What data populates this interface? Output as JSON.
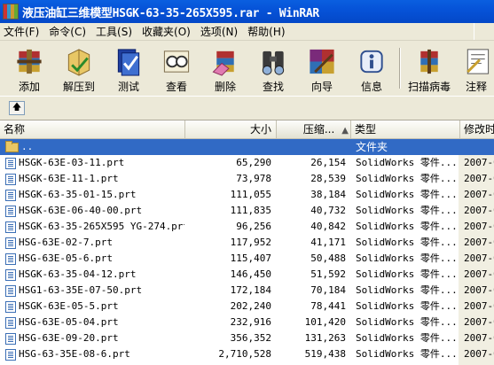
{
  "window": {
    "title": "液压油缸三维模型HSGK-63-35-265X595.rar - WinRAR"
  },
  "menu": [
    "文件(F)",
    "命令(C)",
    "工具(S)",
    "收藏夹(O)",
    "选项(N)",
    "帮助(H)"
  ],
  "toolbar": [
    {
      "label": "添加",
      "icon": "add-archive-icon"
    },
    {
      "label": "解压到",
      "icon": "extract-to-icon"
    },
    {
      "label": "测试",
      "icon": "test-icon"
    },
    {
      "label": "查看",
      "icon": "view-icon"
    },
    {
      "label": "删除",
      "icon": "delete-icon"
    },
    {
      "label": "查找",
      "icon": "find-icon"
    },
    {
      "label": "向导",
      "icon": "wizard-icon"
    },
    {
      "label": "信息",
      "icon": "info-icon"
    },
    {
      "label": "扫描病毒",
      "icon": "scan-virus-icon"
    },
    {
      "label": "注释",
      "icon": "comment-icon"
    }
  ],
  "columns": {
    "name": "名称",
    "size": "大小",
    "packed": "压缩...",
    "type": "类型",
    "modified": "修改时"
  },
  "parent_row": {
    "name": "..",
    "type": "文件夹"
  },
  "files": [
    {
      "name": "HSGK-63E-03-11.prt",
      "size": "65,290",
      "packed": "26,154",
      "type": "SolidWorks 零件...",
      "date": "2007-0"
    },
    {
      "name": "HSGK-63E-11-1.prt",
      "size": "73,978",
      "packed": "28,539",
      "type": "SolidWorks 零件...",
      "date": "2007-0"
    },
    {
      "name": "HSGK-63-35-01-15.prt",
      "size": "111,055",
      "packed": "38,184",
      "type": "SolidWorks 零件...",
      "date": "2007-0"
    },
    {
      "name": "HSGK-63E-06-40-00.prt",
      "size": "111,835",
      "packed": "40,732",
      "type": "SolidWorks 零件...",
      "date": "2007-0"
    },
    {
      "name": "HSGK-63-35-265X595 YG-274.prt",
      "size": "96,256",
      "packed": "40,842",
      "type": "SolidWorks 零件...",
      "date": "2007-0"
    },
    {
      "name": "HSG-63E-02-7.prt",
      "size": "117,952",
      "packed": "41,171",
      "type": "SolidWorks 零件...",
      "date": "2007-0"
    },
    {
      "name": "HSG-63E-05-6.prt",
      "size": "115,407",
      "packed": "50,488",
      "type": "SolidWorks 零件...",
      "date": "2007-0"
    },
    {
      "name": "HSGK-63-35-04-12.prt",
      "size": "146,450",
      "packed": "51,592",
      "type": "SolidWorks 零件...",
      "date": "2007-0"
    },
    {
      "name": "HSG1-63-35E-07-50.prt",
      "size": "172,184",
      "packed": "70,184",
      "type": "SolidWorks 零件...",
      "date": "2007-0"
    },
    {
      "name": "HSGK-63E-05-5.prt",
      "size": "202,240",
      "packed": "78,441",
      "type": "SolidWorks 零件...",
      "date": "2007-0"
    },
    {
      "name": "HSG-63E-05-04.prt",
      "size": "232,916",
      "packed": "101,420",
      "type": "SolidWorks 零件...",
      "date": "2007-0"
    },
    {
      "name": "HSG-63E-09-20.prt",
      "size": "356,352",
      "packed": "131,263",
      "type": "SolidWorks 零件...",
      "date": "2007-0"
    },
    {
      "name": "HSG-63-35E-08-6.prt",
      "size": "2,710,528",
      "packed": "519,438",
      "type": "SolidWorks 零件...",
      "date": "2007-0"
    }
  ]
}
